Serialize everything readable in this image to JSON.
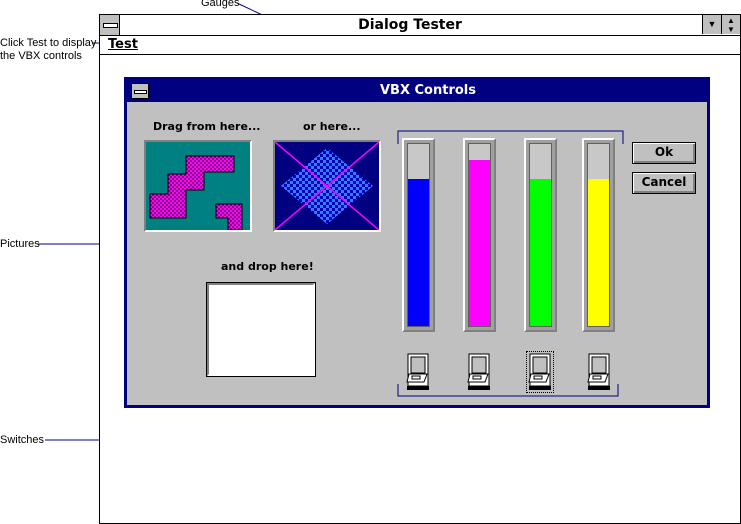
{
  "callouts": {
    "gauges": "Gauges",
    "test_line1": "Click Test to display",
    "test_line2": "the VBX controls",
    "pictures": "Pictures",
    "switches": "Switches"
  },
  "outer_window": {
    "title": "Dialog Tester",
    "menu_test": "Test"
  },
  "vbx_dialog": {
    "title": "VBX Controls",
    "drag_label": "Drag from here...",
    "or_label": "or here...",
    "drop_label": "and drop here!",
    "ok_label": "Ok",
    "cancel_label": "Cancel",
    "gauges": [
      {
        "color": "#0000ff",
        "value": 0.81
      },
      {
        "color": "#ff00ff",
        "value": 0.91
      },
      {
        "color": "#00ff00",
        "value": 0.81
      },
      {
        "color": "#ffff00",
        "value": 0.81
      }
    ],
    "switches": [
      {
        "focused": false
      },
      {
        "focused": false
      },
      {
        "focused": true
      },
      {
        "focused": false
      }
    ]
  },
  "colors": {
    "dialog_title": "#000080",
    "face": "#c0c0c0",
    "teal": "#008080",
    "purple": "#800080"
  }
}
